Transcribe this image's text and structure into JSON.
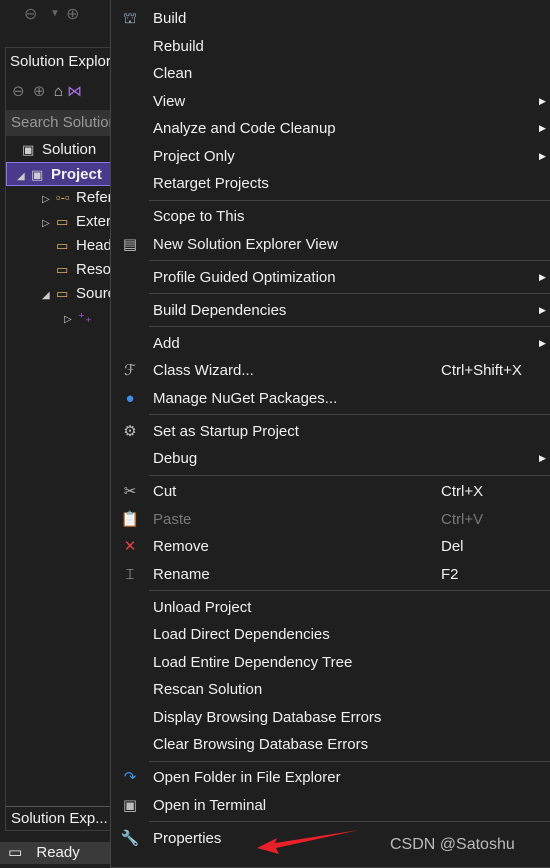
{
  "solution_explorer": {
    "title": "Solution Explorer",
    "search_placeholder": "Search Solution Explorer",
    "footer": "Solution Exp...",
    "tree": [
      {
        "label": "Solution",
        "icon": "solution-icon"
      },
      {
        "label": "Project",
        "icon": "project-icon",
        "selected": true
      },
      {
        "label": "References",
        "icon": "references-icon"
      },
      {
        "label": "External Dependencies",
        "icon": "external-folder-icon"
      },
      {
        "label": "Header Files",
        "icon": "filter-folder-icon"
      },
      {
        "label": "Resource Files",
        "icon": "filter-folder-icon"
      },
      {
        "label": "Source Files",
        "icon": "filter-folder-icon"
      },
      {
        "label": "",
        "icon": "cpp-file-icon"
      }
    ]
  },
  "status": {
    "text": "Ready"
  },
  "menu": [
    {
      "label": "Build",
      "icon": "build-icon"
    },
    {
      "label": "Rebuild"
    },
    {
      "label": "Clean"
    },
    {
      "label": "View",
      "submenu": true
    },
    {
      "label": "Analyze and Code Cleanup",
      "submenu": true
    },
    {
      "label": "Project Only",
      "submenu": true
    },
    {
      "label": "Retarget Projects"
    },
    {
      "sep": true
    },
    {
      "label": "Scope to This"
    },
    {
      "label": "New Solution Explorer View",
      "icon": "new-view-icon"
    },
    {
      "sep": true
    },
    {
      "label": "Profile Guided Optimization",
      "submenu": true
    },
    {
      "sep": true
    },
    {
      "label": "Build Dependencies",
      "submenu": true
    },
    {
      "sep": true
    },
    {
      "label": "Add",
      "submenu": true
    },
    {
      "label": "Class Wizard...",
      "icon": "class-wizard-icon",
      "shortcut": "Ctrl+Shift+X"
    },
    {
      "label": "Manage NuGet Packages...",
      "icon": "nuget-icon"
    },
    {
      "sep": true
    },
    {
      "label": "Set as Startup Project",
      "icon": "gear-icon"
    },
    {
      "label": "Debug",
      "submenu": true
    },
    {
      "sep": true
    },
    {
      "label": "Cut",
      "icon": "scissors-icon",
      "shortcut": "Ctrl+X"
    },
    {
      "label": "Paste",
      "icon": "paste-icon",
      "shortcut": "Ctrl+V",
      "disabled": true
    },
    {
      "label": "Remove",
      "icon": "remove-x-icon",
      "shortcut": "Del"
    },
    {
      "label": "Rename",
      "icon": "rename-icon",
      "shortcut": "F2"
    },
    {
      "sep": true
    },
    {
      "label": "Unload Project"
    },
    {
      "label": "Load Direct Dependencies"
    },
    {
      "label": "Load Entire Dependency Tree"
    },
    {
      "label": "Rescan Solution"
    },
    {
      "label": "Display Browsing Database Errors"
    },
    {
      "label": "Clear Browsing Database Errors"
    },
    {
      "sep": true
    },
    {
      "label": "Open Folder in File Explorer",
      "icon": "redo-arrow-icon"
    },
    {
      "label": "Open in Terminal",
      "icon": "terminal-icon"
    },
    {
      "sep": true
    },
    {
      "label": "Properties",
      "icon": "wrench-icon"
    }
  ],
  "watermark": "CSDN @Satoshu",
  "colors": {
    "selection": "#4a3a8c",
    "arrow": "#e8202a",
    "remove": "#e04040",
    "accent": "#3c8ee8"
  }
}
